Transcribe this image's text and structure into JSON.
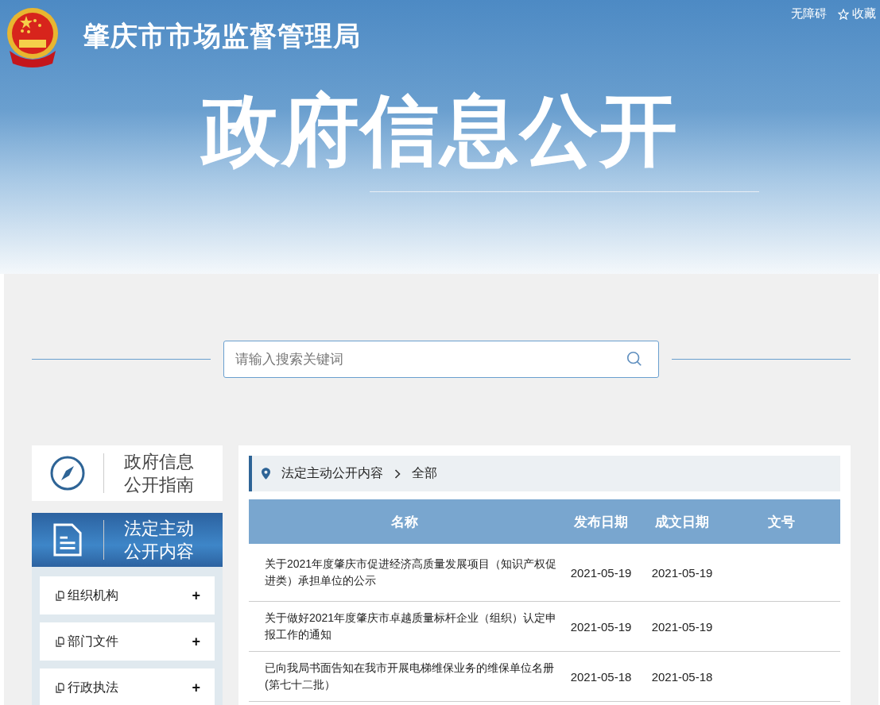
{
  "header": {
    "site_name": "肇庆市市场监督管理局",
    "links": [
      {
        "kind": "text",
        "label": "无障碍"
      },
      {
        "kind": "star",
        "label": "收藏"
      }
    ],
    "banner_title": "政府信息公开"
  },
  "search": {
    "placeholder": "请输入搜索关键词"
  },
  "sidebar": {
    "cards": [
      {
        "kind": "guide",
        "lines": [
          "政府信息",
          "公开指南"
        ],
        "selected": false
      },
      {
        "kind": "document",
        "lines": [
          "法定主动",
          "公开内容"
        ],
        "selected": true
      }
    ],
    "items": [
      {
        "label": "组织机构",
        "toggle": "+"
      },
      {
        "label": "部门文件",
        "toggle": "+"
      },
      {
        "label": "行政执法",
        "toggle": "+"
      }
    ]
  },
  "breadcrumb": [
    "法定主动公开内容",
    "全部"
  ],
  "table": {
    "columns": [
      "名称",
      "发布日期",
      "成文日期",
      "文号"
    ],
    "rows": [
      {
        "name": "关于2021年度肇庆市促进经济高质量发展项目（知识产权促进类）承担单位的公示",
        "published": "2021-05-19",
        "written": "2021-05-19"
      },
      {
        "name": "关于做好2021年度肇庆市卓越质量标杆企业（组织）认定申报工作的通知",
        "published": "2021-05-19",
        "written": "2021-05-19"
      },
      {
        "name": "已向我局书面告知在我市开展电梯维保业务的维保单位名册(第七十二批）",
        "published": "2021-05-18",
        "written": "2021-05-18"
      }
    ]
  }
}
